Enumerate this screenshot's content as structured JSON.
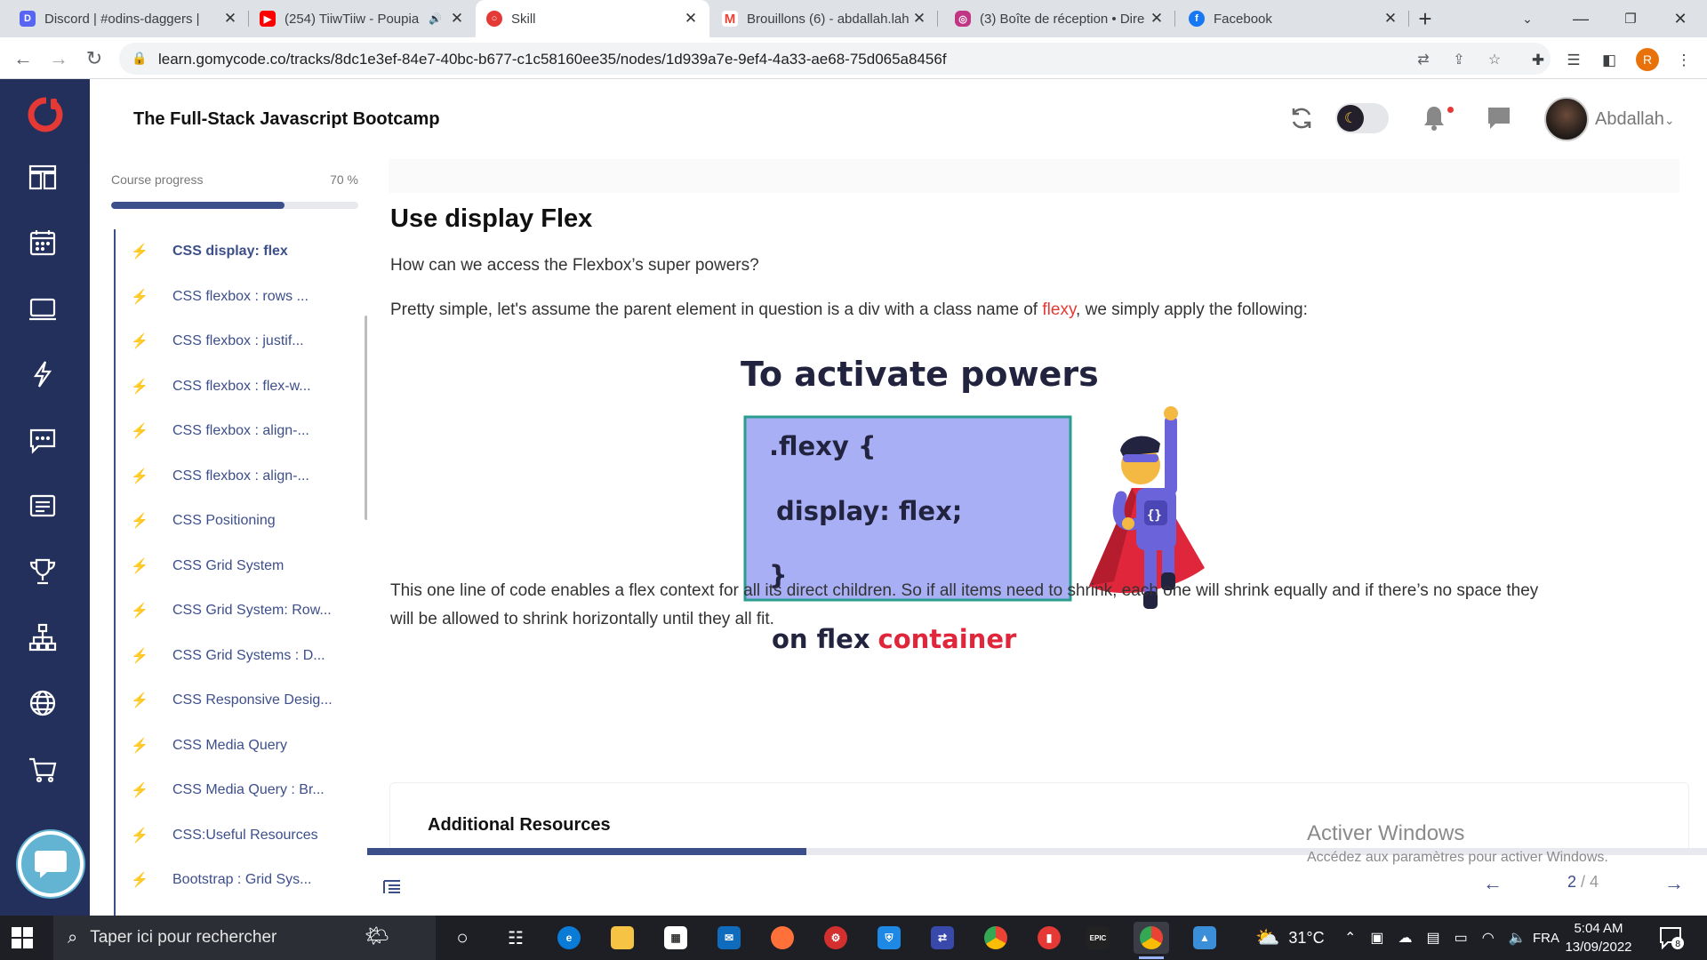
{
  "browser": {
    "tabs": [
      {
        "title": "Discord | #odins-daggers | ",
        "favicon": "discord-icon",
        "color": "#5865f2",
        "active": false
      },
      {
        "title": "(254) TiiwTiiw - Poupia",
        "favicon": "youtube-icon",
        "color": "#ff0000",
        "active": false,
        "audio": true
      },
      {
        "title": "Skill",
        "favicon": "gomycode-icon",
        "color": "#e53935",
        "active": true
      },
      {
        "title": "Brouillons (6) - abdallah.lah",
        "favicon": "gmail-icon",
        "color": "#ea4335",
        "active": false
      },
      {
        "title": "(3) Boîte de réception • Dire",
        "favicon": "instagram-icon",
        "color": "#c13584",
        "active": false
      },
      {
        "title": "Facebook",
        "favicon": "facebook-icon",
        "color": "#1877f2",
        "active": false
      }
    ],
    "url": "learn.gomycode.co/tracks/8dc1e3ef-84e7-40bc-b677-c1c58160ee35/nodes/1d939a7e-9ef4-4a33-ae68-75d065a8456f",
    "profile_initial": "R"
  },
  "app": {
    "title": "The Full-Stack Javascript Bootcamp",
    "username": "Abdallah",
    "nav_icons": [
      "dashboard-icon",
      "calendar-icon",
      "laptop-icon",
      "bolt-icon",
      "chat-icon",
      "document-icon",
      "trophy-icon",
      "hierarchy-icon",
      "globe-icon",
      "cart-icon"
    ]
  },
  "sidebar": {
    "progress_label": "Course progress",
    "progress_text": "70 %",
    "progress_value": 0.7,
    "lessons": [
      {
        "label": "CSS display: flex",
        "active": true
      },
      {
        "label": "CSS flexbox : rows ..."
      },
      {
        "label": "CSS flexbox : justif..."
      },
      {
        "label": "CSS flexbox : flex-w..."
      },
      {
        "label": "CSS flexbox : align-..."
      },
      {
        "label": "CSS flexbox : align-..."
      },
      {
        "label": "CSS Positioning"
      },
      {
        "label": "CSS Grid System"
      },
      {
        "label": "CSS Grid System: Row..."
      },
      {
        "label": "CSS Grid Systems : D..."
      },
      {
        "label": "CSS Responsive Desig..."
      },
      {
        "label": "CSS Media Query"
      },
      {
        "label": "CSS Media Query : Br..."
      },
      {
        "label": "CSS:Useful Resources"
      },
      {
        "label": "Bootstrap : Grid Sys..."
      }
    ]
  },
  "content": {
    "title": "Use display Flex",
    "intro": "How can we access the Flexbox’s super powers?",
    "para2_before": "Pretty simple, let's assume the parent element in question is a div with a class name of ",
    "para2_highlight": "flexy",
    "para2_after": ", we simply apply the following:",
    "illustration": {
      "heading": "To activate powers",
      "code_line1": ".flexy {",
      "code_line2": "display: flex;",
      "code_line3": "}",
      "caption_dark": "on flex",
      "caption_red": "container",
      "hero_badge": "{}"
    },
    "para3_line1": "This one line of code enables a flex context for all its direct children. So if all items need to shrink, each one will shrink equally and if there’s no space they",
    "para3_line2": "will be allowed to shrink horizontally until they all fit.",
    "resources_title": "Additional Resources",
    "page_progress": 0.328,
    "page_current": "2",
    "page_total": "/ 4"
  },
  "watermark": {
    "line1": "Activer Windows",
    "line2": "Accédez aux paramètres pour activer Windows."
  },
  "taskbar": {
    "search_placeholder": "Taper ici pour rechercher",
    "temperature": "31°C",
    "language": "FRA",
    "time": "5:04 AM",
    "date": "13/09/2022",
    "notifications": "8"
  }
}
